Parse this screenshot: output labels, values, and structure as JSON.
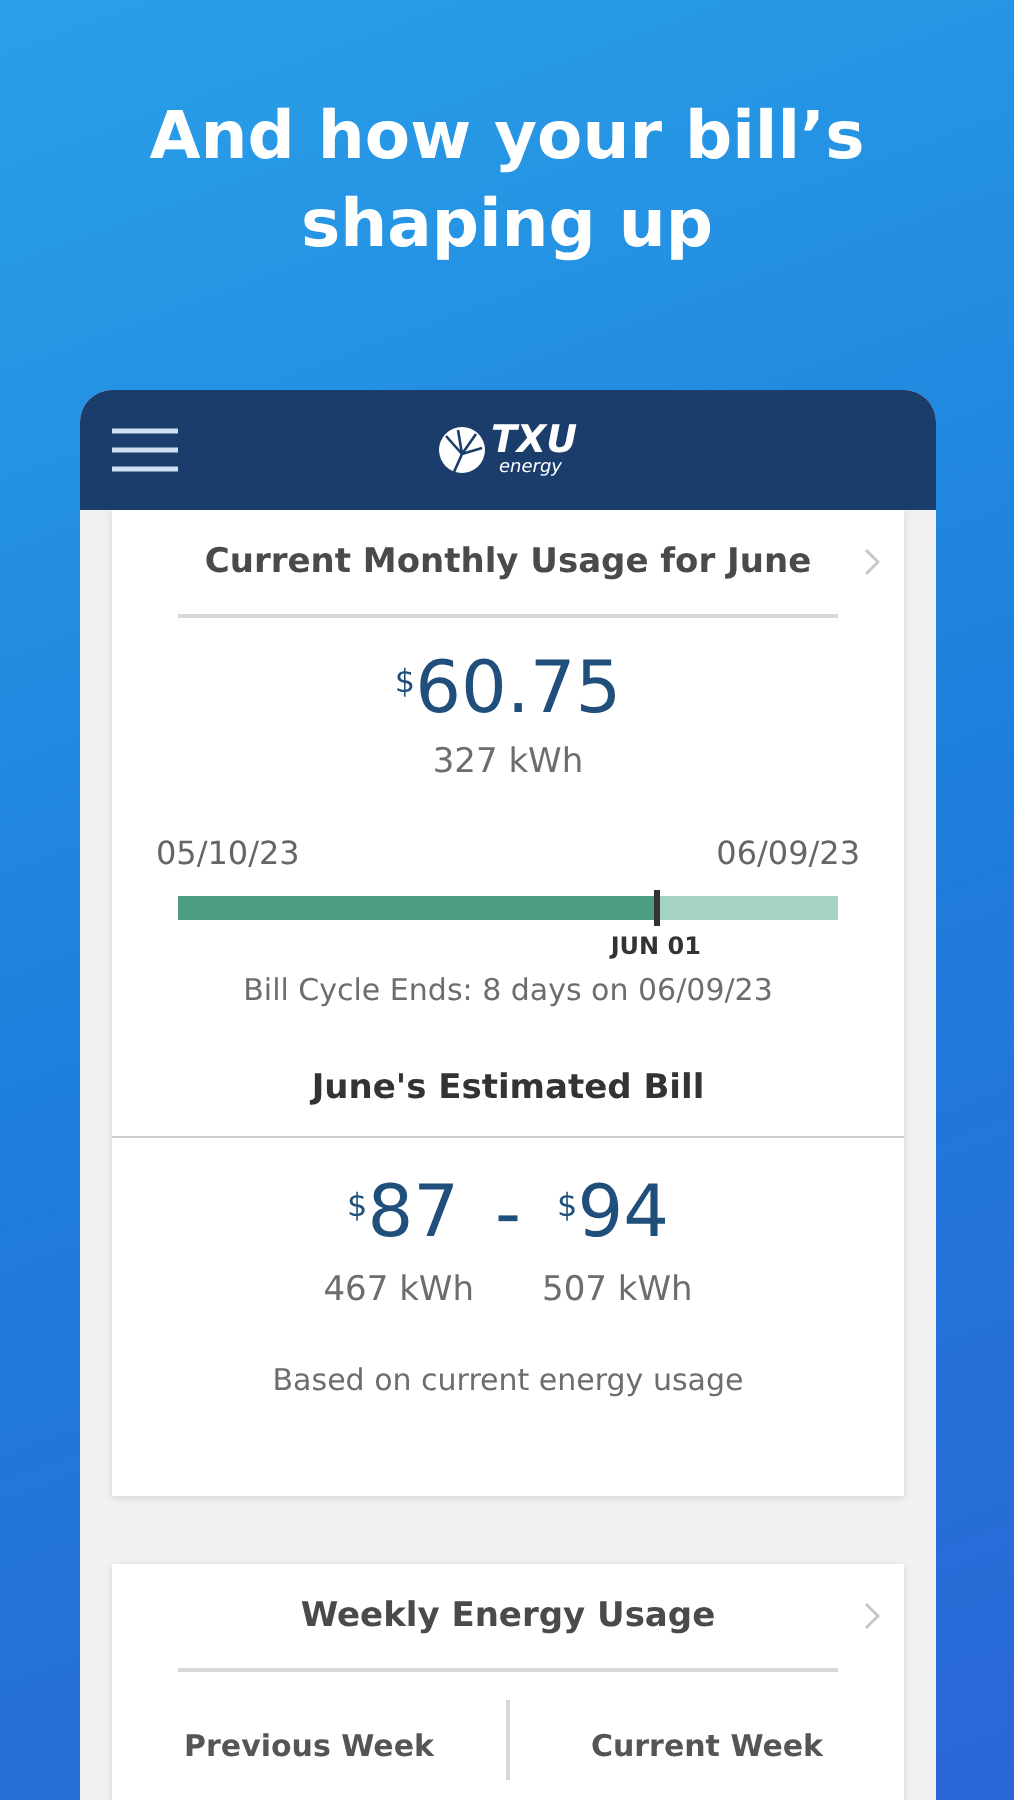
{
  "headline": "And how your bill’s shaping up",
  "header": {
    "logo_text": "TXU",
    "logo_subtext": "energy"
  },
  "monthly_usage": {
    "title": "Current Monthly Usage for June",
    "amount": {
      "symbol": "$",
      "value": "60.75"
    },
    "usage": "327 kWh",
    "start_date": "05/10/23",
    "end_date": "06/09/23",
    "level": 0.724,
    "marker_label": "JUN 01",
    "cycle_text": "Bill Cycle Ends: 8 days on 06/09/23"
  },
  "estimated_bill": {
    "title": "June's Estimated Bill",
    "low_amount": {
      "symbol": "$",
      "value": "87"
    },
    "separator": "-",
    "high_amount": {
      "symbol": "$",
      "value": "94"
    },
    "low_usage": "467 kWh",
    "high_usage": "507 kWh",
    "note": "Based on current energy usage"
  },
  "weekly_usage": {
    "title": "Weekly Energy Usage",
    "columns": [
      "Previous Week",
      "Current Week"
    ]
  }
}
